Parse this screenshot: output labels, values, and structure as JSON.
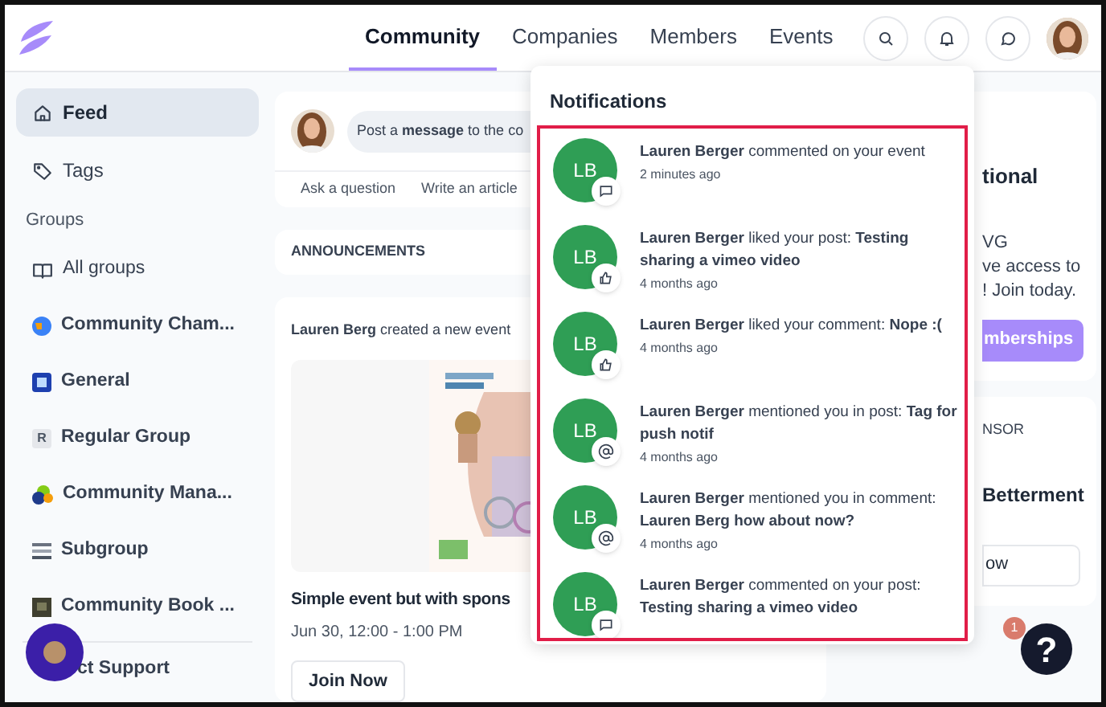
{
  "nav": {
    "tabs": [
      {
        "label": "Community",
        "selected": true
      },
      {
        "label": "Companies",
        "selected": false
      },
      {
        "label": "Members",
        "selected": false
      },
      {
        "label": "Events",
        "selected": false
      }
    ]
  },
  "sidebar": {
    "items": [
      {
        "label": "Feed",
        "kind": "home",
        "selected": true
      },
      {
        "label": "Tags",
        "kind": "tag",
        "selected": false
      }
    ],
    "groups_heading": "Groups",
    "groups": [
      {
        "label": "All groups",
        "kind": "book"
      },
      {
        "label": "Community Cham...",
        "kind": "globe"
      },
      {
        "label": "General",
        "kind": "square"
      },
      {
        "label": "Regular Group",
        "kind": "letter",
        "letter": "R"
      },
      {
        "label": "Community Mana...",
        "kind": "blobs"
      },
      {
        "label": "Subgroup",
        "kind": "stripes"
      },
      {
        "label": "Community Book ...",
        "kind": "dark"
      }
    ],
    "support": "ct Support"
  },
  "composer": {
    "placeholder": "Post a **message** to the co",
    "actions": [
      "Ask a question",
      "Write an article"
    ]
  },
  "announcements": {
    "title": "ANNOUNCEMENTS"
  },
  "event_post": {
    "actor": "Lauren Berg",
    "action": "created a new event",
    "title": "Simple event but with spons",
    "date": "Jun 30, 12:00 - 1:00 PM",
    "button": "Join Now"
  },
  "right": {
    "card_1": {
      "title": "tional",
      "lines": [
        "VG",
        "ve access to",
        "! Join today."
      ],
      "button": "mberships"
    },
    "card_2": {
      "heading": "NSOR",
      "title": "Betterment",
      "button": "ow"
    }
  },
  "notifications": {
    "title": "Notifications",
    "items": [
      {
        "initials": "LB",
        "kind": "comment",
        "text": "**Lauren Berger** commented on your event",
        "time": "2 minutes ago"
      },
      {
        "initials": "LB",
        "kind": "like",
        "text": "**Lauren Berger** liked your post: **Testing sharing a vimeo video**",
        "time": "4 months ago"
      },
      {
        "initials": "LB",
        "kind": "like",
        "text": "**Lauren Berger** liked your comment: **Nope :(**",
        "time": "4 months ago"
      },
      {
        "initials": "LB",
        "kind": "mention",
        "text": "**Lauren Berger** mentioned you in post: **Tag for push notif**",
        "time": "4 months ago"
      },
      {
        "initials": "LB",
        "kind": "mention",
        "text": "**Lauren Berger** mentioned you in comment: **Lauren Berg how about now?**",
        "time": "4 months ago"
      },
      {
        "initials": "LB",
        "kind": "comment",
        "text": "**Lauren Berger** commented on your post: **Testing sharing a vimeo video**"
      }
    ]
  },
  "help": {
    "label": "?",
    "badge": "1"
  }
}
